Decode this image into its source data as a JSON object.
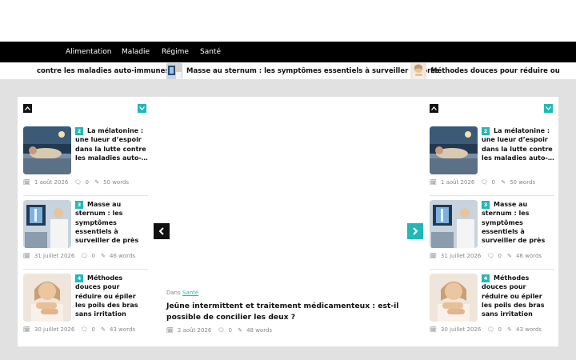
{
  "nav": {
    "items": [
      "Alimentation",
      "Maladie",
      "Régime",
      "Santé"
    ]
  },
  "ticker": {
    "items": [
      {
        "title": "contre les maladies auto-immunes",
        "icon": "melatonin-thumb"
      },
      {
        "title": "Masse au sternum : les symptômes essentiels à surveiller de près",
        "icon": "xray-thumb"
      },
      {
        "title": "Méthodes douces pour réduire ou",
        "icon": "arms-thumb"
      }
    ]
  },
  "left_column": {
    "items": [
      {
        "rank": "2",
        "title": "La mélatonine : une lueur d’espoir dans la lutte contre les maladies auto-…",
        "date": "1 août 2026",
        "comments": "0",
        "words": "50 words"
      },
      {
        "rank": "3",
        "title": "Masse au sternum : les symptômes essentiels à surveiller de près",
        "date": "31 juillet 2026",
        "comments": "0",
        "words": "46 words"
      },
      {
        "rank": "4",
        "title": "Méthodes douces pour réduire ou épiler les poils des bras sans irritation",
        "date": "30 juillet 2026",
        "comments": "0",
        "words": "43 words"
      }
    ]
  },
  "right_column": {
    "items": [
      {
        "rank": "2",
        "title": "La mélatonine : une lueur d’espoir dans la lutte contre les maladies auto-…",
        "date": "1 août 2026",
        "comments": "0",
        "words": "50 words"
      },
      {
        "rank": "3",
        "title": "Masse au sternum : les symptômes essentiels à surveiller de près",
        "date": "31 juillet 2026",
        "comments": "0",
        "words": "46 words"
      },
      {
        "rank": "4",
        "title": "Méthodes douces pour réduire ou épiler les poils des bras sans irritation",
        "date": "30 juillet 2026",
        "comments": "0",
        "words": "43 words"
      }
    ]
  },
  "featured": {
    "category_prefix": "Dans",
    "category": "Santé",
    "title": "Jeûne intermittent et traitement médicamenteux : est-il possible de concilier les deux ?",
    "date": "2 août 2026",
    "comments": "0",
    "words": "48 words"
  },
  "colors": {
    "accent": "#23b8b8",
    "nav_bg": "#000000",
    "page_bg": "#e1e1e1"
  }
}
